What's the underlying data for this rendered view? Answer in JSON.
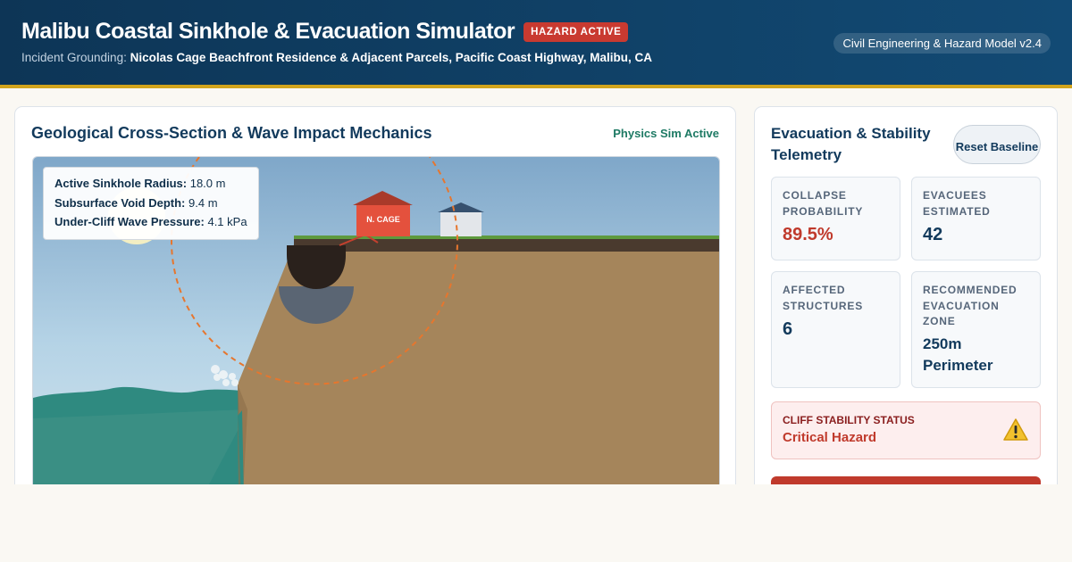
{
  "header": {
    "title": "Malibu Coastal Sinkhole & Evacuation Simulator",
    "badge": "HAZARD ACTIVE",
    "subtitle_prefix": "Incident Grounding:",
    "subtitle_location": "Nicolas Cage Beachfront Residence & Adjacent Parcels, Pacific Coast Highway, Malibu, CA",
    "version": "Civil Engineering & Hazard Model v2.4"
  },
  "cross_section": {
    "title": "Geological Cross-Section & Wave Impact Mechanics",
    "status": "Physics Sim Active",
    "house_label": "N. CAGE",
    "metrics": [
      {
        "label": "Active Sinkhole Radius:",
        "value": "18.0 m"
      },
      {
        "label": "Subsurface Void Depth:",
        "value": "9.4 m"
      },
      {
        "label": "Under-Cliff Wave Pressure:",
        "value": "4.1 kPa"
      }
    ]
  },
  "telemetry": {
    "title": "Evacuation & Stability Telemetry",
    "reset_label": "Reset Baseline",
    "cards": [
      {
        "label": "COLLAPSE PROBABILITY",
        "value": "89.5%"
      },
      {
        "label": "EVACUEES ESTIMATED",
        "value": "42"
      },
      {
        "label": "AFFECTED STRUCTURES",
        "value": "6"
      },
      {
        "label": "RECOMMENDED EVACUATION ZONE",
        "value": "250m Perimeter"
      }
    ],
    "stability": {
      "label": "CLIFF STABILITY STATUS",
      "value": "Critical Hazard"
    }
  },
  "colors": {
    "header": "#0d3556",
    "accent_line": "#d2a41c",
    "hazard": "#c03a2c",
    "sim_status": "#1e7a64",
    "cliff": "#a5855b",
    "sea": "#2f8a80"
  },
  "icons": {
    "warning": "warning-triangle-icon"
  }
}
